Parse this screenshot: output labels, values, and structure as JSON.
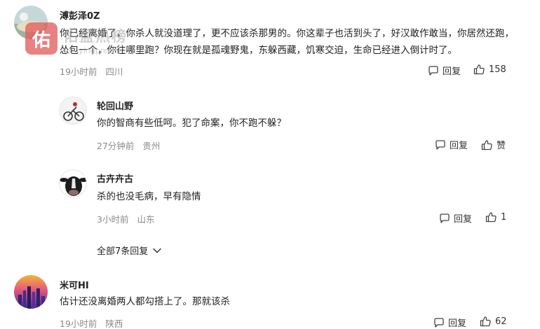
{
  "watermark": {
    "badge": "佑",
    "title": "佑盈热榜",
    "url": "youyingprecision.com"
  },
  "comments": [
    {
      "author": "溥彭泽0Z",
      "text": "你已经离婚了，你杀人就没道理了，更不应该杀那男的。你这辈子也活到头了，好汉敢作敢当，你居然还跑，怂包一个，你往哪里跑？你现在就是孤魂野鬼，东躲西藏，饥寒交迫，生命已经进入倒计时了。",
      "time": "19小时前",
      "location": "四川",
      "reply_label": "回复",
      "like_label": "158"
    },
    {
      "author": "轮回山野",
      "text": "你的智商有些低呵。犯了命案，你不跑不躲？",
      "time": "27分钟前",
      "location": "贵州",
      "reply_label": "回复",
      "like_label": "赞"
    },
    {
      "author": "古卉卉古",
      "text": "杀的也没毛病，早有隐情",
      "time": "3小时前",
      "location": "山东",
      "reply_label": "回复",
      "like_label": "1"
    },
    {
      "author": "米可HI",
      "text": "估计还没离婚两人都勾搭上了。那就该杀",
      "time": "19小时前",
      "location": "陕西",
      "reply_label": "回复",
      "like_label": "62"
    }
  ],
  "expand_replies": "全部7条回复",
  "icons": {
    "reply": "comment-bubble-icon",
    "like": "thumbs-up-icon",
    "expand": "chevron-down-icon"
  }
}
